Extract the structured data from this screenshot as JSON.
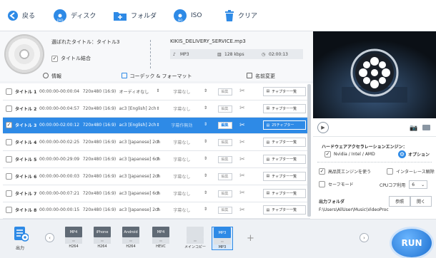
{
  "toolbar": {
    "back": "戻る",
    "disc": "ディスク",
    "folder": "フォルダ",
    "iso": "ISO",
    "clear": "クリア"
  },
  "info": {
    "selected_title": "選ばれたタイトル：タイトル3",
    "merge_label": "タイトル結合",
    "merge_checked": true,
    "filename": "KIKIS_DELIVERY_SERVICE.mp3",
    "format": "MP3",
    "bitrate": "128 kbps",
    "duration": "02:00:13"
  },
  "tabs": {
    "info": "情報",
    "codec": "コーデック & フォーマット",
    "rename": "名前変更"
  },
  "titles": [
    {
      "name": "タイトル 1",
      "time": "00:00:00-00:00:04",
      "res": "720x480 (16:9)",
      "audio": "オーディオなし",
      "sub": "字幕なし",
      "edit": "編集",
      "chapters": "チャプター一覧",
      "checked": false,
      "selected": false
    },
    {
      "name": "タイトル 2",
      "time": "00:00:00-00:04:57",
      "res": "720x480 (16:9)",
      "audio": "ac3 [English] 2ch",
      "sub": "字幕なし",
      "edit": "編集",
      "chapters": "チャプター一覧",
      "checked": false,
      "selected": false
    },
    {
      "name": "タイトル 3",
      "time": "00:00:00-02:00:12",
      "res": "720x480 (16:9)",
      "audio": "ac3 [English] 2ch",
      "sub": "字幕作無効",
      "edit": "編集",
      "chapters": "25チャプター",
      "checked": true,
      "selected": true
    },
    {
      "name": "タイトル 4",
      "time": "00:00:00-00:02:25",
      "res": "720x480 (16:9)",
      "audio": "ac3 [Japanese] 2ch",
      "sub": "字幕なし",
      "edit": "編集",
      "chapters": "チャプター一覧",
      "checked": false,
      "selected": false
    },
    {
      "name": "タイトル 5",
      "time": "00:00:00-00:29:09",
      "res": "720x480 (16:9)",
      "audio": "ac3 [Japanese] 6ch",
      "sub": "字幕なし",
      "edit": "編集",
      "chapters": "チャプター一覧",
      "checked": false,
      "selected": false
    },
    {
      "name": "タイトル 6",
      "time": "00:00:00-00:00:03",
      "res": "720x480 (16:9)",
      "audio": "ac3 [Japanese] 2ch",
      "sub": "字幕なし",
      "edit": "編集",
      "chapters": "チャプター一覧",
      "checked": false,
      "selected": false
    },
    {
      "name": "タイトル 7",
      "time": "00:00:00-00:07:21",
      "res": "720x480 (16:9)",
      "audio": "ac3 [Japanese] 6ch",
      "sub": "字幕なし",
      "edit": "編集",
      "chapters": "チャプター一覧",
      "checked": false,
      "selected": false
    },
    {
      "name": "タイトル 8",
      "time": "00:00:00-00:00:15",
      "res": "720x480 (16:9)",
      "audio": "ac3 [Japanese] 2ch",
      "sub": "字幕なし",
      "edit": "編集",
      "chapters": "チャプター一覧",
      "checked": false,
      "selected": false
    }
  ],
  "hw": {
    "title": "ハードウェアアクセラレーションエンジン：",
    "engine": "Nvidia / Intel / AMD",
    "engine_checked": true,
    "options": "オプション",
    "hq": "高品質エンジンを使う",
    "hq_checked": true,
    "deinterlace": "インターレース解除",
    "deinterlace_checked": false,
    "safe": "セーフモード",
    "safe_checked": false,
    "cpu_label": "CPUコア利用",
    "cpu_value": "6"
  },
  "output": {
    "label": "出力フォルダ",
    "browse": "参照",
    "open": "開く",
    "path": "F:\\Users\\AllUser\\Music\\VideoProc"
  },
  "bottom": {
    "output_label": "出力",
    "run": "RUN"
  },
  "formats": [
    {
      "top": "MP4",
      "codec": "H264",
      "sel": false
    },
    {
      "top": "iPhone",
      "codec": "H264",
      "sel": false
    },
    {
      "top": "Android",
      "codec": "H264",
      "sel": false
    },
    {
      "top": "MP4",
      "codec": "HEVC",
      "sel": false
    },
    {
      "top": "",
      "codec": "メインコピー",
      "sel": false
    },
    {
      "top": "MP3",
      "codec": "MP3",
      "sel": true
    }
  ]
}
